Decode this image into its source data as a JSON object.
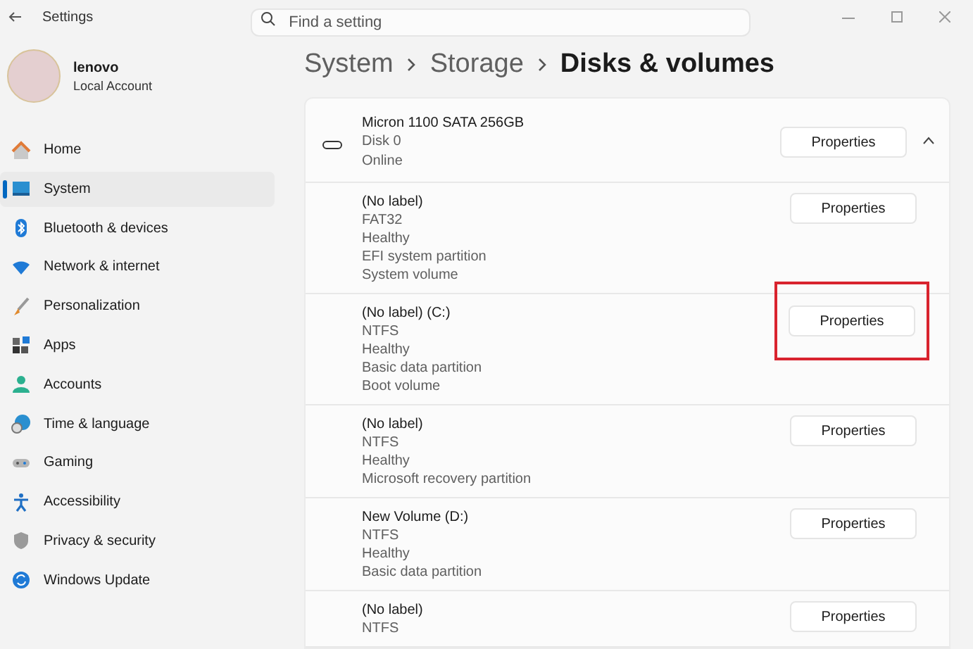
{
  "window": {
    "title": "Settings"
  },
  "search": {
    "placeholder": "Find a setting"
  },
  "profile": {
    "name": "lenovo",
    "account_type": "Local Account"
  },
  "nav": [
    {
      "kind": "home",
      "label": "Home",
      "selected": false
    },
    {
      "kind": "system",
      "label": "System",
      "selected": true
    },
    {
      "kind": "bluetooth",
      "label": "Bluetooth & devices",
      "selected": false
    },
    {
      "kind": "network",
      "label": "Network & internet",
      "selected": false
    },
    {
      "kind": "personalization",
      "label": "Personalization",
      "selected": false
    },
    {
      "kind": "apps",
      "label": "Apps",
      "selected": false
    },
    {
      "kind": "accounts",
      "label": "Accounts",
      "selected": false
    },
    {
      "kind": "time",
      "label": "Time & language",
      "selected": false
    },
    {
      "kind": "gaming",
      "label": "Gaming",
      "selected": false
    },
    {
      "kind": "accessibility",
      "label": "Accessibility",
      "selected": false
    },
    {
      "kind": "privacy",
      "label": "Privacy & security",
      "selected": false
    },
    {
      "kind": "update",
      "label": "Windows Update",
      "selected": false
    }
  ],
  "breadcrumb": [
    "System",
    "Storage",
    "Disks & volumes"
  ],
  "disk": {
    "name": "Micron 1100 SATA 256GB",
    "details": [
      "Disk 0",
      "Online"
    ],
    "button": "Properties",
    "expanded": true
  },
  "partitions": [
    {
      "lines": [
        "(No label)",
        "FAT32",
        "Healthy",
        "EFI system partition",
        "System volume"
      ],
      "button": "Properties",
      "highlighted": false
    },
    {
      "lines": [
        "(No label) (C:)",
        "NTFS",
        "Healthy",
        "Basic data partition",
        "Boot volume"
      ],
      "button": "Properties",
      "highlighted": true
    },
    {
      "lines": [
        "(No label)",
        "NTFS",
        "Healthy",
        "Microsoft recovery partition"
      ],
      "button": "Properties",
      "highlighted": false
    },
    {
      "lines": [
        "New Volume (D:)",
        "NTFS",
        "Healthy",
        "Basic data partition"
      ],
      "button": "Properties",
      "highlighted": false
    },
    {
      "lines": [
        "(No label)",
        "NTFS"
      ],
      "button": "Properties",
      "highlighted": false
    }
  ]
}
